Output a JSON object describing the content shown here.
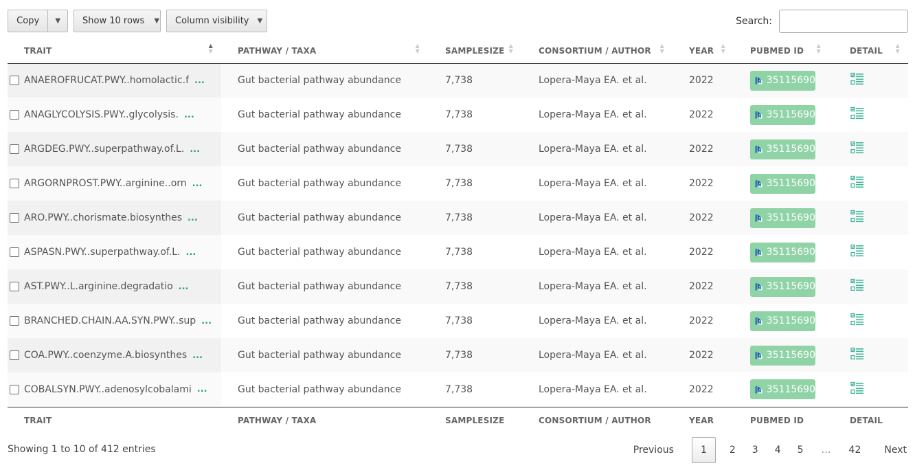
{
  "toolbar": {
    "copy_label": "Copy",
    "rows_label": "Show 10 rows",
    "visibility_label": "Column visibility",
    "caret": "▼"
  },
  "search": {
    "label": "Search:",
    "value": ""
  },
  "columns": [
    "TRAIT",
    "PATHWAY / TAXA",
    "SAMPLESIZE",
    "CONSORTIUM / AUTHOR",
    "YEAR",
    "PUBMED ID",
    "DETAIL"
  ],
  "rows": [
    {
      "trait": "ANAEROFRUCAT.PWY..homolactic.f",
      "pathway": "Gut bacterial pathway abundance",
      "samplesize": "7,738",
      "author": "Lopera-Maya EA. et al.",
      "year": "2022",
      "pubmed": "35115690"
    },
    {
      "trait": "ANAGLYCOLYSIS.PWY..glycolysis.",
      "pathway": "Gut bacterial pathway abundance",
      "samplesize": "7,738",
      "author": "Lopera-Maya EA. et al.",
      "year": "2022",
      "pubmed": "35115690"
    },
    {
      "trait": "ARGDEG.PWY..superpathway.of.L.",
      "pathway": "Gut bacterial pathway abundance",
      "samplesize": "7,738",
      "author": "Lopera-Maya EA. et al.",
      "year": "2022",
      "pubmed": "35115690"
    },
    {
      "trait": "ARGORNPROST.PWY..arginine..orn",
      "pathway": "Gut bacterial pathway abundance",
      "samplesize": "7,738",
      "author": "Lopera-Maya EA. et al.",
      "year": "2022",
      "pubmed": "35115690"
    },
    {
      "trait": "ARO.PWY..chorismate.biosynthes",
      "pathway": "Gut bacterial pathway abundance",
      "samplesize": "7,738",
      "author": "Lopera-Maya EA. et al.",
      "year": "2022",
      "pubmed": "35115690"
    },
    {
      "trait": "ASPASN.PWY..superpathway.of.L.",
      "pathway": "Gut bacterial pathway abundance",
      "samplesize": "7,738",
      "author": "Lopera-Maya EA. et al.",
      "year": "2022",
      "pubmed": "35115690"
    },
    {
      "trait": "AST.PWY..L.arginine.degradatio",
      "pathway": "Gut bacterial pathway abundance",
      "samplesize": "7,738",
      "author": "Lopera-Maya EA. et al.",
      "year": "2022",
      "pubmed": "35115690"
    },
    {
      "trait": "BRANCHED.CHAIN.AA.SYN.PWY..sup",
      "pathway": "Gut bacterial pathway abundance",
      "samplesize": "7,738",
      "author": "Lopera-Maya EA. et al.",
      "year": "2022",
      "pubmed": "35115690"
    },
    {
      "trait": "COA.PWY..coenzyme.A.biosynthes",
      "pathway": "Gut bacterial pathway abundance",
      "samplesize": "7,738",
      "author": "Lopera-Maya EA. et al.",
      "year": "2022",
      "pubmed": "35115690"
    },
    {
      "trait": "COBALSYN.PWY..adenosylcobalami",
      "pathway": "Gut bacterial pathway abundance",
      "samplesize": "7,738",
      "author": "Lopera-Maya EA. et al.",
      "year": "2022",
      "pubmed": "35115690"
    }
  ],
  "more_marker": "...",
  "info": "Showing 1 to 10 of 412 entries",
  "pagination": {
    "previous": "Previous",
    "pages": [
      "1",
      "2",
      "3",
      "4",
      "5",
      "…",
      "42"
    ],
    "current": "1",
    "next": "Next"
  },
  "colors": {
    "badge": "#8fd3a6",
    "accent": "#2a9d8f"
  },
  "icons": {
    "pubmed": "pubmed-logo-icon",
    "detail": "detail-list-icon",
    "sort": "sort-icon"
  }
}
